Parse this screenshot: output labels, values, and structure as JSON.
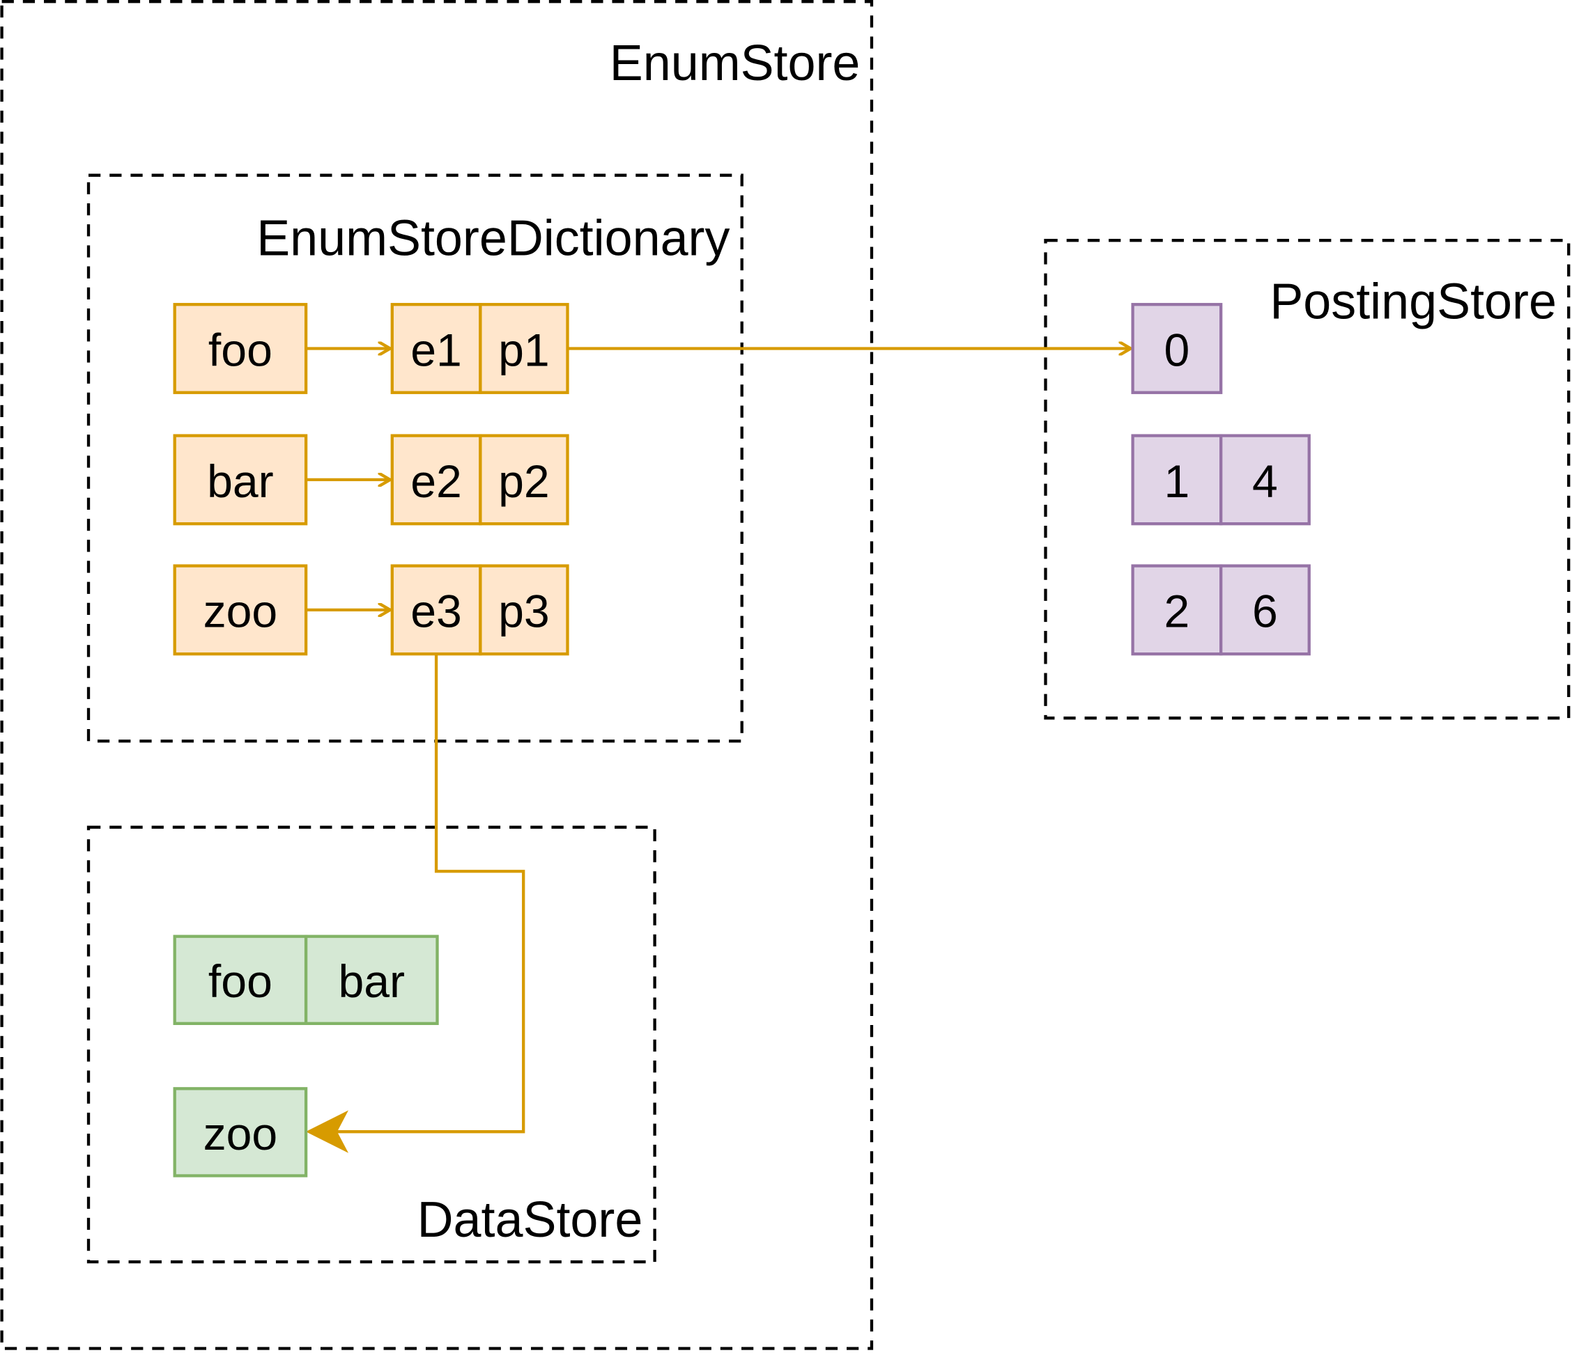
{
  "colors": {
    "orange_fill": "#ffe6cc",
    "orange_stroke": "#d79b00",
    "green_fill": "#d5e8d4",
    "green_stroke": "#82b366",
    "purple_fill": "#e1d5e7",
    "purple_stroke": "#9673a6",
    "edge": "#d79b00"
  },
  "containers": {
    "enum_store": "EnumStore",
    "enum_store_dictionary": "EnumStoreDictionary",
    "data_store": "DataStore",
    "posting_store": "PostingStore"
  },
  "dictionary": {
    "keys": [
      "foo",
      "bar",
      "zoo"
    ],
    "entries": [
      [
        "e1",
        "p1"
      ],
      [
        "e2",
        "p2"
      ],
      [
        "e3",
        "p3"
      ]
    ]
  },
  "data_store": {
    "row1": [
      "foo",
      "bar"
    ],
    "row2": [
      "zoo"
    ]
  },
  "posting_store": {
    "rows": [
      [
        "0"
      ],
      [
        "1",
        "4"
      ],
      [
        "2",
        "6"
      ]
    ]
  }
}
